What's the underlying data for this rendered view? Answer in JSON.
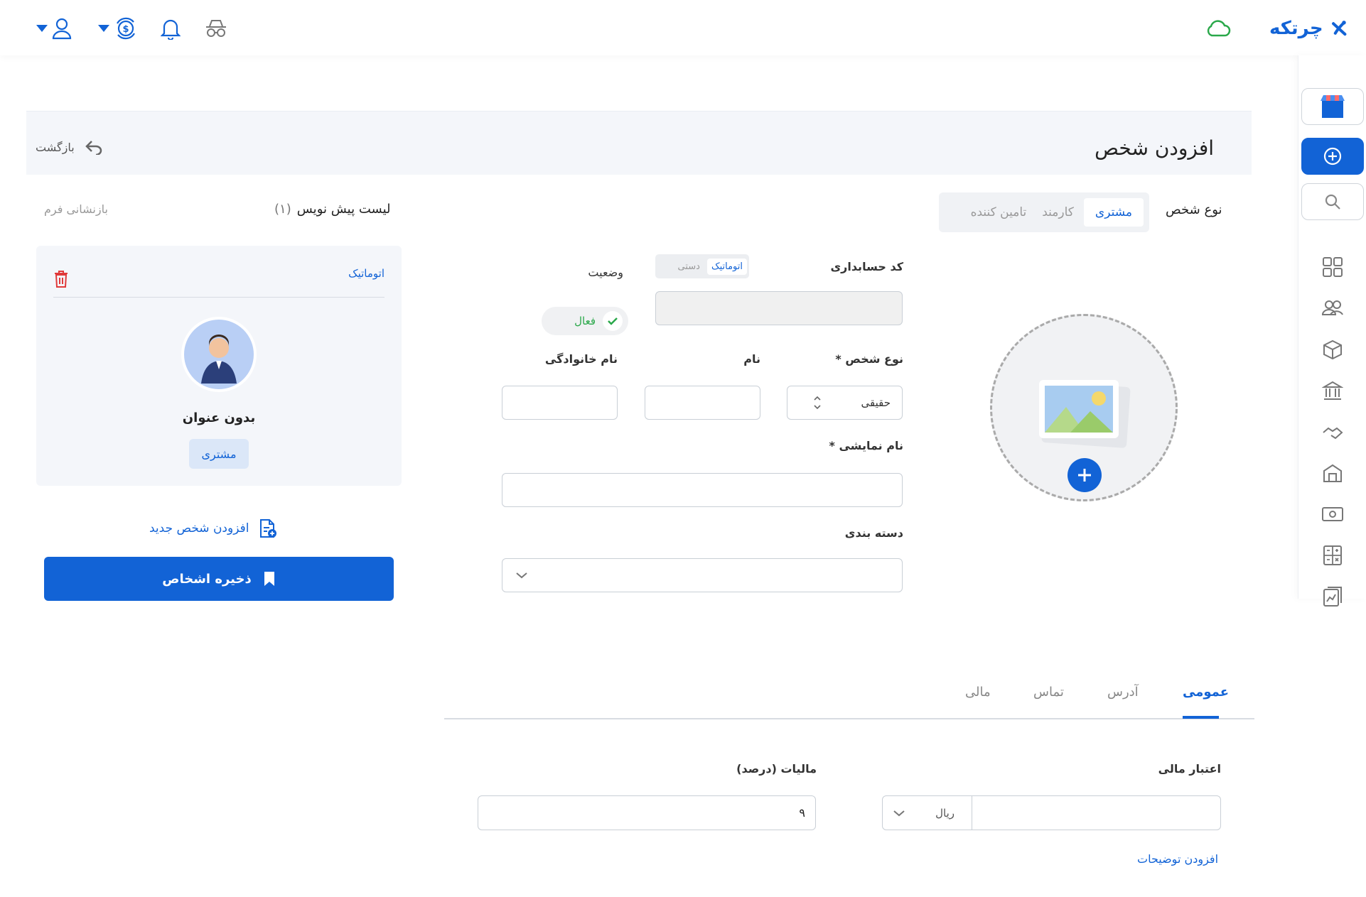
{
  "brand": {
    "name": "چرتکه",
    "color": "#1263d6"
  },
  "topbar": {
    "icons": [
      "user-icon",
      "coin-exchange-icon",
      "bell-icon",
      "incognito-icon",
      "cloud-icon"
    ]
  },
  "sidebar": {
    "items": [
      "store-icon",
      "add-icon",
      "search-icon",
      "dashboard-icon",
      "people-icon",
      "box-icon",
      "bank-icon",
      "handshake-icon",
      "warehouse-icon",
      "cash-icon",
      "calculator-icon",
      "report-icon"
    ]
  },
  "header": {
    "title": "افزودن شخص",
    "back_label": "بازگشت"
  },
  "person_type": {
    "label": "نوع شخص",
    "tabs": [
      {
        "label": "مشتری",
        "active": true
      },
      {
        "label": "کارمند",
        "active": false
      },
      {
        "label": "تامین کننده",
        "active": false
      }
    ]
  },
  "form": {
    "accounting_code": {
      "label": "کد حسابداری",
      "auto_label": "اتوماتیک",
      "manual_label": "دستی",
      "value": ""
    },
    "status": {
      "label": "وضعیت",
      "value": "فعال"
    },
    "entity_type": {
      "label": "نوع شخص *",
      "value": "حقیقی"
    },
    "first_name": {
      "label": "نام",
      "value": ""
    },
    "last_name": {
      "label": "نام خانوادگی",
      "value": ""
    },
    "display_name": {
      "label": "نام نمایشی *",
      "value": ""
    },
    "category": {
      "label": "دسته بندی",
      "value": ""
    }
  },
  "draft": {
    "list_label": "لیست پیش نویس",
    "count": "(۱)",
    "reset_label": "بازنشانی فرم",
    "card_mode": "اتوماتیک",
    "card_name": "بدون عنوان",
    "card_badge": "مشتری",
    "add_new_label": "افزودن شخص جدید",
    "save_label": "ذخیره اشخاص"
  },
  "bottom_tabs": [
    {
      "label": "عمومی",
      "active": true
    },
    {
      "label": "آدرس",
      "active": false
    },
    {
      "label": "تماس",
      "active": false
    },
    {
      "label": "مالی",
      "active": false
    }
  ],
  "financial": {
    "credit_label": "اعتبار مالی",
    "currency": "ریال",
    "tax_label": "مالیات (درصد)",
    "tax_value": "۹",
    "add_notes_label": "افزودن توضیحات"
  }
}
